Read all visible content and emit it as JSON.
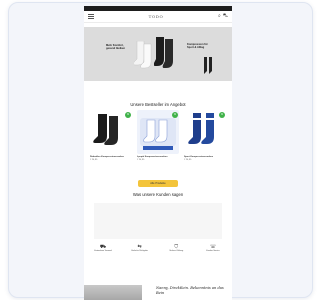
{
  "nav": {
    "logo": "TODO",
    "cart_count": "0"
  },
  "hero": {
    "left_text": "Mehr Komfort, gesund bleiben",
    "right_text": "Kompression für Sport & Alltag"
  },
  "bestsellers": {
    "title": "Unsere Bestseller im Angebot",
    "products": [
      {
        "name": "Diabetiker Kompressionssocken",
        "price": "€ 24,95",
        "badge": "%"
      },
      {
        "name": "Lymph Kompressionssocken",
        "price": "€ 24,95",
        "badge": "%"
      },
      {
        "name": "Sport Kompressionssocken",
        "price": "€ 24,95",
        "badge": "%"
      }
    ],
    "cta": "Alle Produkte"
  },
  "reviews": {
    "title": "Was unsere Kunden sagen"
  },
  "features": [
    {
      "icon": "truck-icon",
      "glyph": "⛟",
      "label": "Kostenloser Versand"
    },
    {
      "icon": "return-icon",
      "glyph": "⇆",
      "label": "Einfache Rückgabe"
    },
    {
      "icon": "shield-icon",
      "glyph": "⛉",
      "label": "Sichere Zahlung"
    },
    {
      "icon": "support-icon",
      "glyph": "☏",
      "label": "Kunden Service"
    }
  ],
  "bottom": {
    "signature": "Nanny, Direktlein. Bekenntnis an das Bein"
  },
  "colors": {
    "accent": "#f3c43b",
    "badge": "#40b24a",
    "hero_bg": "#dcdcdc"
  }
}
